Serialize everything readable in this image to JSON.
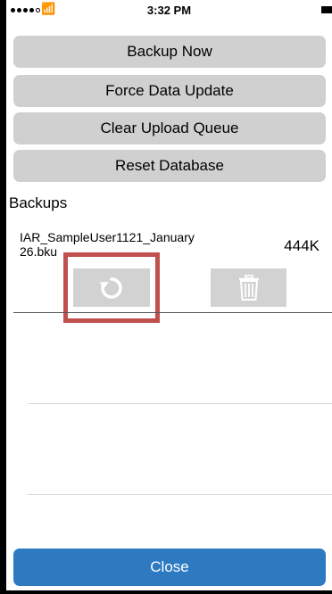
{
  "status_bar": {
    "time": "3:32 PM"
  },
  "actions": {
    "backup_now": "Backup Now",
    "force_data_update": "Force Data Update",
    "clear_upload_queue": "Clear Upload Queue",
    "reset_database": "Reset Database"
  },
  "backups": {
    "title": "Backups",
    "items": [
      {
        "file_name": "IAR_SampleUser1121_January 26.bku",
        "size": "444K"
      }
    ]
  },
  "close_label": "Close",
  "colors": {
    "button_gray": "#d0d0d0",
    "close_blue": "#2d7ac1",
    "highlight_red": "#c0504d"
  },
  "icons": {
    "restore": "refresh-icon",
    "delete": "trash-icon"
  }
}
